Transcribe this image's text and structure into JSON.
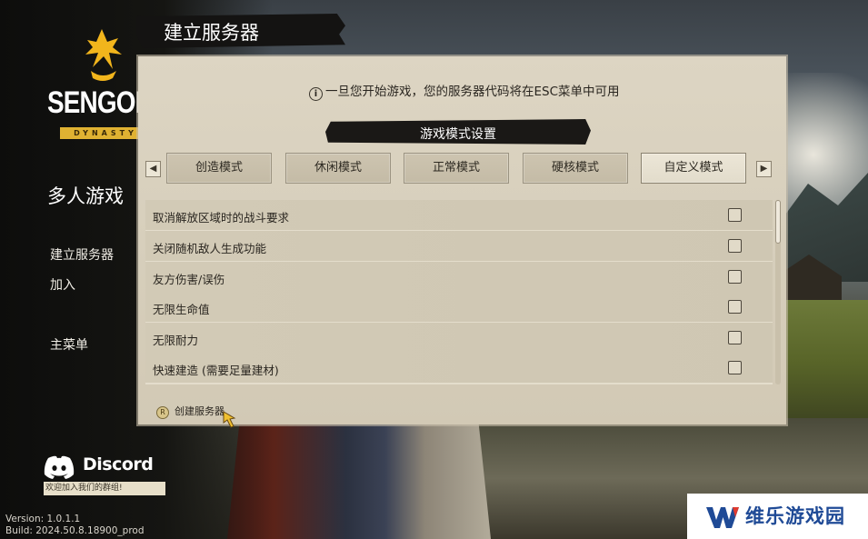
{
  "header": {
    "title": "建立服务器"
  },
  "logo": {
    "word": "SENGOKU",
    "sub": "DYNASTY"
  },
  "sidebar": {
    "title": "多人游戏",
    "items": [
      {
        "label": "建立服务器"
      },
      {
        "label": "加入"
      },
      {
        "label": "主菜单"
      }
    ]
  },
  "panel": {
    "info": "一旦您开始游戏，您的服务器代码将在ESC菜单中可用",
    "section_title": "游戏模式设置",
    "tabs": [
      {
        "label": "创造模式",
        "active": false
      },
      {
        "label": "休闲模式",
        "active": false
      },
      {
        "label": "正常模式",
        "active": false
      },
      {
        "label": "硬核模式",
        "active": false
      },
      {
        "label": "自定义模式",
        "active": true
      }
    ],
    "options": [
      {
        "label": "取消解放区域时的战斗要求",
        "checked": false
      },
      {
        "label": "关闭随机敌人生成功能",
        "checked": false
      },
      {
        "label": "友方伤害/误伤",
        "checked": false
      },
      {
        "label": "无限生命值",
        "checked": false
      },
      {
        "label": "无限耐力",
        "checked": false
      },
      {
        "label": "快速建造 (需要足量建材)",
        "checked": false
      }
    ],
    "create_key": "R",
    "create_label": "创建服务器"
  },
  "discord": {
    "word": "Discord",
    "subtitle": "欢迎加入我们的群组!"
  },
  "version": {
    "version_line": "Version: 1.0.1.1",
    "build_line": "Build: 2024.50.8.18900_prod"
  },
  "watermark": {
    "text": "维乐游戏园"
  },
  "colors": {
    "logo_gold": "#f2b51c",
    "watermark_blue": "#1f4a96",
    "panel": "#d7cfbc"
  }
}
